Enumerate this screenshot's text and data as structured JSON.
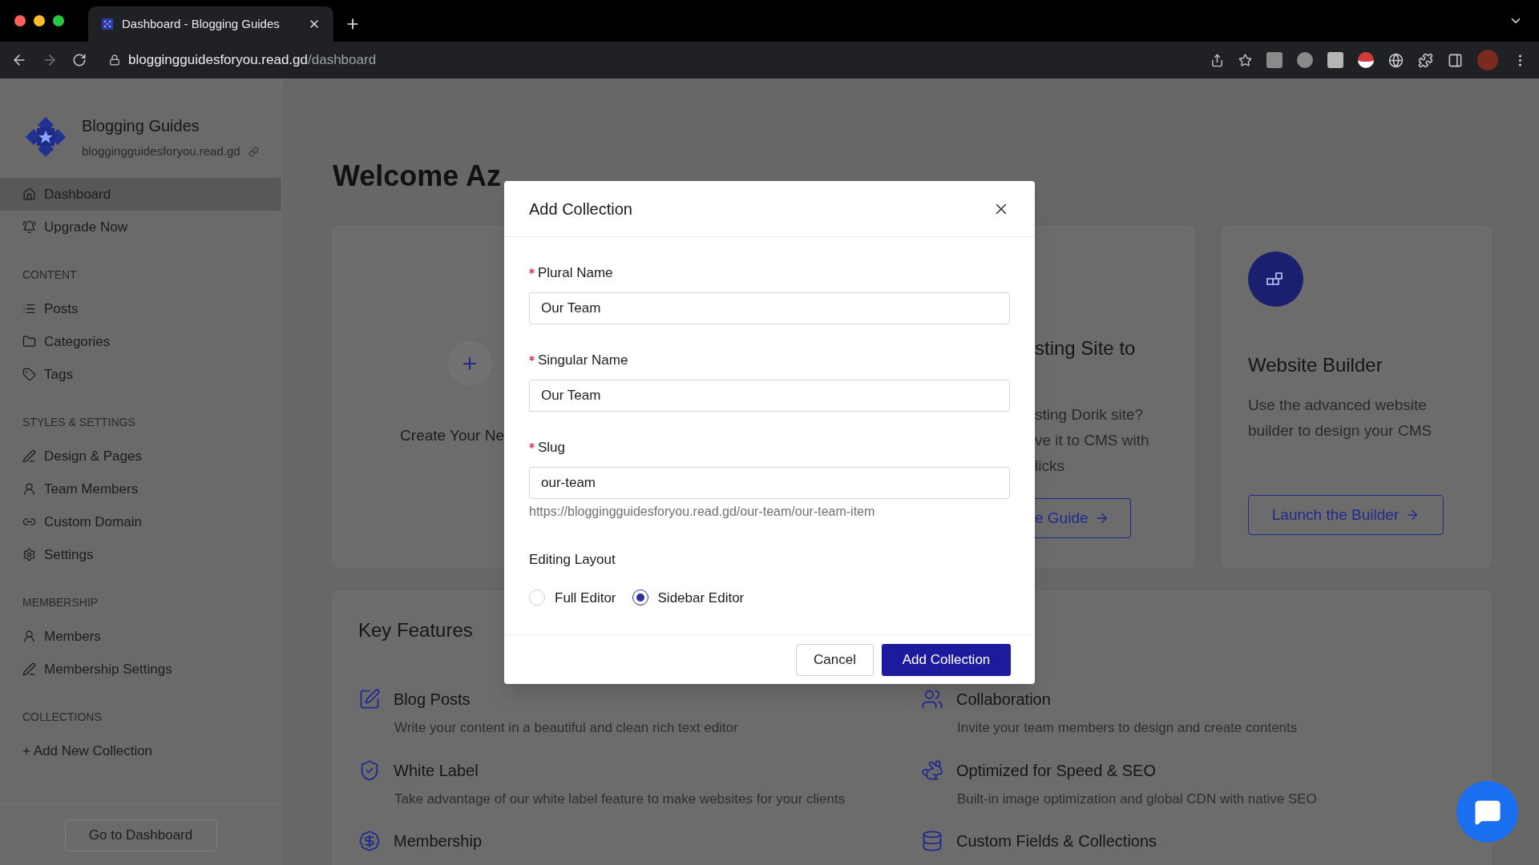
{
  "browser": {
    "tab_title": "Dashboard - Blogging Guides",
    "url_host": "bloggingguidesforyou.read.gd",
    "url_path": "/dashboard"
  },
  "sidebar": {
    "site_name": "Blogging Guides",
    "site_url": "bloggingguidesforyou.read.gd",
    "top": [
      {
        "label": "Dashboard",
        "selected": true
      },
      {
        "label": "Upgrade Now",
        "selected": false
      }
    ],
    "sections": [
      {
        "title": "CONTENT",
        "items": [
          {
            "label": "Posts",
            "selected": false
          },
          {
            "label": "Categories",
            "selected": false
          },
          {
            "label": "Tags",
            "selected": false
          }
        ]
      },
      {
        "title": "STYLES & SETTINGS",
        "items": [
          {
            "label": "Design & Pages",
            "selected": false
          },
          {
            "label": "Team Members",
            "selected": false
          },
          {
            "label": "Custom Domain",
            "selected": false
          },
          {
            "label": "Settings",
            "selected": false
          }
        ]
      },
      {
        "title": "MEMBERSHIP",
        "items": [
          {
            "label": "Members",
            "selected": false
          },
          {
            "label": "Membership Settings",
            "selected": false
          }
        ]
      }
    ],
    "collections": {
      "title": "COLLECTIONS",
      "add_link": "+ Add New Collection"
    },
    "footer_button": "Go to Dashboard"
  },
  "main": {
    "heading": "Welcome Az",
    "create_card": {
      "text": "Create Your Ne"
    },
    "import_card": {
      "title": "sting Site to",
      "lines": [
        "sting Dorik site?",
        "ve it to CMS with",
        "licks"
      ],
      "button": "e Guide"
    },
    "builder_card": {
      "title": "Website Builder",
      "description": "Use the advanced website builder to design your CMS",
      "button": "Launch the Builder"
    },
    "key_features": {
      "title": "Key Features",
      "items": [
        {
          "title": "Blog Posts",
          "description": "Write your content in a beautiful and clean rich text editor"
        },
        {
          "title": "Collaboration",
          "description": "Invite your team members to design and create contents"
        },
        {
          "title": "White Label",
          "description": "Take advantage of our white label feature to make websites for your clients"
        },
        {
          "title": "Optimized for Speed & SEO",
          "description": "Built-in image optimization and global CDN with native SEO"
        },
        {
          "title": "Membership"
        },
        {
          "title": "Custom Fields & Collections"
        }
      ]
    }
  },
  "dialog": {
    "title": "Add Collection",
    "fields": [
      {
        "label": "Plural Name",
        "value": "Our Team",
        "required": true
      },
      {
        "label": "Singular Name",
        "value": "Our Team",
        "required": true
      },
      {
        "label": "Slug",
        "value": "our-team",
        "required": true,
        "hint": "https://bloggingguidesforyou.read.gd/our-team/our-team-item"
      }
    ],
    "layout_label": "Editing Layout",
    "layouts": [
      {
        "label": "Full Editor",
        "selected": false
      },
      {
        "label": "Sidebar Editor",
        "selected": true
      }
    ],
    "cancel": "Cancel",
    "submit": "Add Collection"
  }
}
